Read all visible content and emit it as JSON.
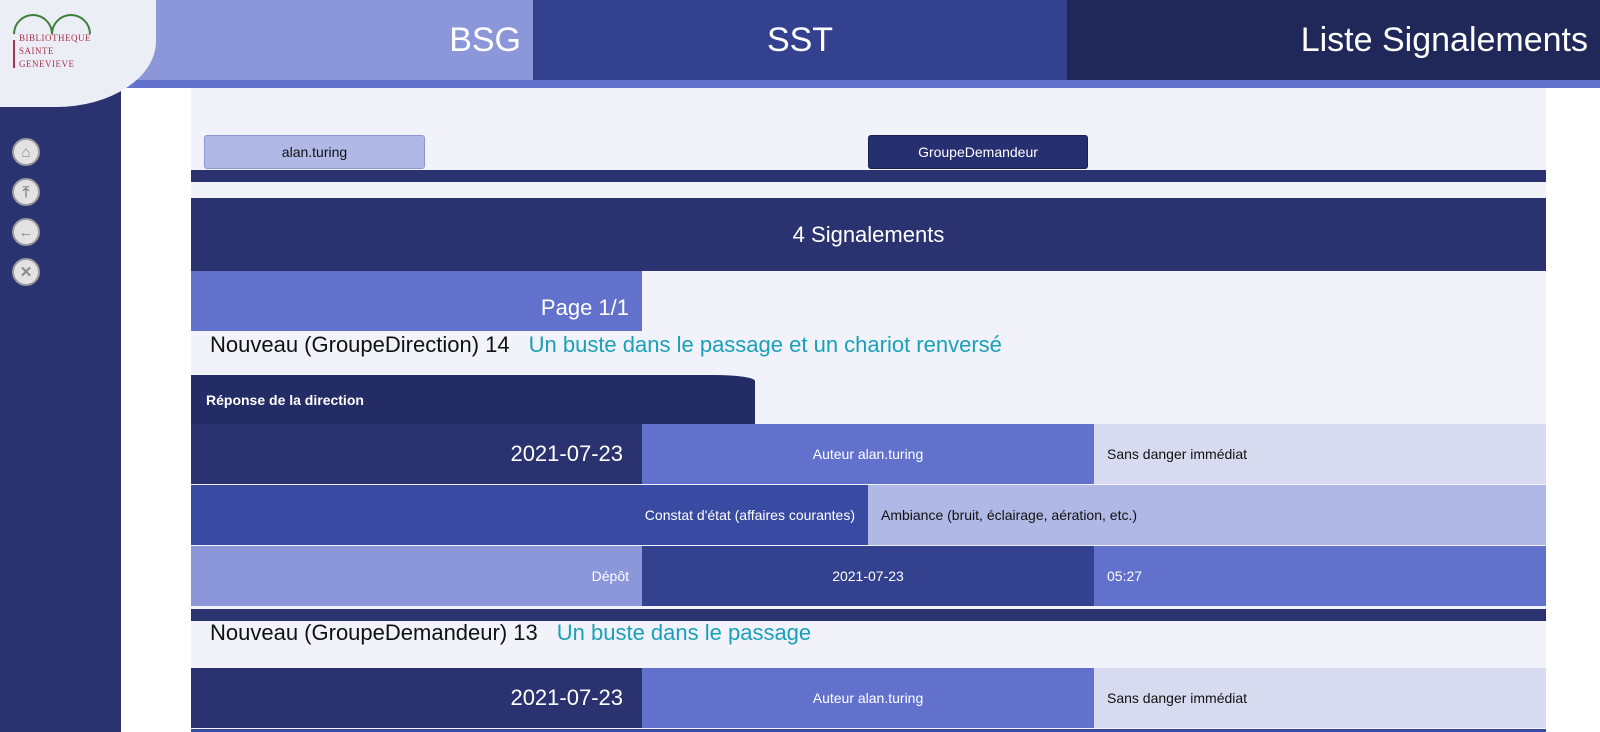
{
  "header": {
    "logo_lines": [
      "BIBLIOTHEQUE",
      "SAINTE",
      "GENEVIEVE"
    ],
    "bsg_label": "BSG",
    "sst_label": "SST",
    "list_title": "Liste Signalements"
  },
  "sidebar": {
    "items": [
      {
        "icon": "home-icon"
      },
      {
        "icon": "top-icon"
      },
      {
        "icon": "back-icon"
      },
      {
        "icon": "close-icon"
      }
    ]
  },
  "user_tabs": {
    "user": "alan.turing",
    "group": "GroupeDemandeur"
  },
  "summary": {
    "count_label": "4 Signalements",
    "page_label": "Page 1/1"
  },
  "entries": [
    {
      "status": "Nouveau (GroupeDirection) 14",
      "subject": "Un buste dans le passage et un chariot renversé",
      "response_tab": "Réponse de la direction",
      "date": "2021-07-23",
      "author": "Auteur alan.turing",
      "danger": "Sans danger immédiat",
      "category": "Constat d'état (affaires courantes)",
      "subcategory": "Ambiance (bruit, éclairage, aération, etc.)",
      "deposit_label": "Dépôt",
      "deposit_date": "2021-07-23",
      "deposit_time": "05:27"
    },
    {
      "status": "Nouveau (GroupeDemandeur) 13",
      "subject": "Un buste dans le passage",
      "date": "2021-07-23",
      "author": "Auteur alan.turing",
      "danger": "Sans danger immédiat"
    }
  ],
  "colors": {
    "navy": "#2a3370",
    "mid_blue": "#6272cc",
    "light_blue": "#8b97d9",
    "subject_teal": "#1aa0b8"
  }
}
